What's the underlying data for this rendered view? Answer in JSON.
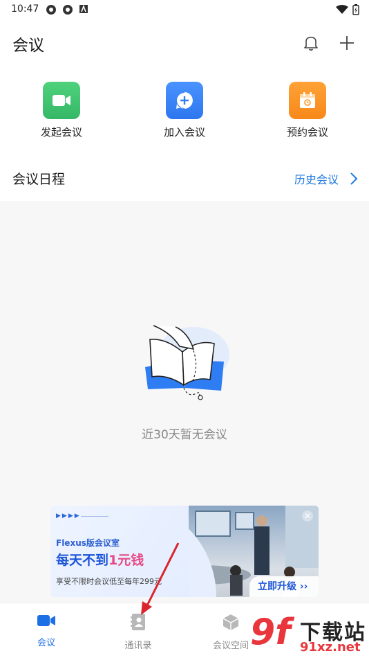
{
  "status": {
    "time": "10:47"
  },
  "header": {
    "title": "会议"
  },
  "actions": [
    {
      "label": "发起会议",
      "color": "#3ec46d",
      "icon": "video-camera-icon"
    },
    {
      "label": "加入会议",
      "color": "#2f7df3",
      "icon": "add-circle-icon"
    },
    {
      "label": "预约会议",
      "color": "#f7941d",
      "icon": "calendar-icon"
    }
  ],
  "schedule": {
    "title": "会议日程",
    "history_link": "历史会议"
  },
  "empty": {
    "text": "近30天暂无会议"
  },
  "banner": {
    "sub": "Flexus版会议室",
    "main_prefix": "每天不到",
    "main_highlight": "1元钱",
    "desc": "享受不限时会议低至每年299元",
    "upgrade": "立即升级"
  },
  "tabs": [
    {
      "label": "会议",
      "active": true,
      "icon": "video-camera-icon"
    },
    {
      "label": "通讯录",
      "active": false,
      "icon": "contacts-icon"
    },
    {
      "label": "会议空间",
      "active": false,
      "icon": "cube-icon"
    }
  ],
  "watermark": {
    "text": "下载站",
    "url": "91xz.net"
  },
  "colors": {
    "accent": "#1d6fe5",
    "link": "#1d79e0",
    "empty_bg": "#f7f7f8"
  }
}
